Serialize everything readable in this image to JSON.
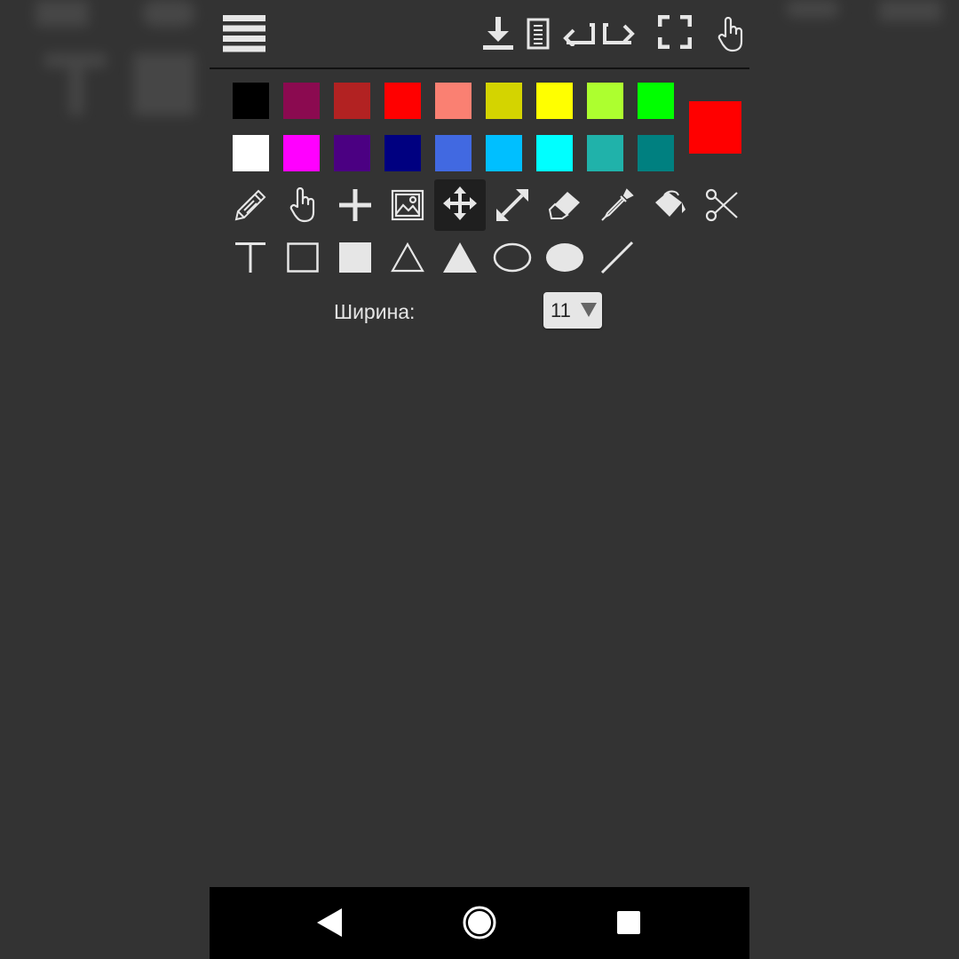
{
  "toolbar": {
    "icons": [
      "menu-icon",
      "download-icon",
      "document-icon",
      "undo-arrow-icon",
      "redo-arrow-icon",
      "fullscreen-icon",
      "hand-pointer-icon"
    ]
  },
  "palette": {
    "row1": [
      "#000000",
      "#8b0a50",
      "#b22222",
      "#ff0000",
      "#fa8072",
      "#d4d400",
      "#ffff00",
      "#adff2f",
      "#00ff00"
    ],
    "row2": [
      "#ffffff",
      "#ff00ff",
      "#4b0082",
      "#000080",
      "#4169e1",
      "#00bfff",
      "#00ffff",
      "#20b2aa",
      "#008080"
    ],
    "current": "#ff0000"
  },
  "tools": {
    "row1": [
      "pencil-icon",
      "hand-pointer-icon",
      "plus-icon",
      "image-icon",
      "move-icon",
      "resize-icon",
      "eraser-icon",
      "eyedropper-icon",
      "fill-bucket-icon",
      "scissors-icon"
    ],
    "row2": [
      "text-icon",
      "rectangle-outline-icon",
      "rectangle-filled-icon",
      "triangle-outline-icon",
      "triangle-filled-icon",
      "ellipse-outline-icon",
      "ellipse-filled-icon",
      "line-icon"
    ],
    "active": "move-icon"
  },
  "width": {
    "label": "Ширина:",
    "value": "11"
  },
  "navbar": {
    "icons": [
      "back-icon",
      "home-icon",
      "recents-icon"
    ]
  }
}
